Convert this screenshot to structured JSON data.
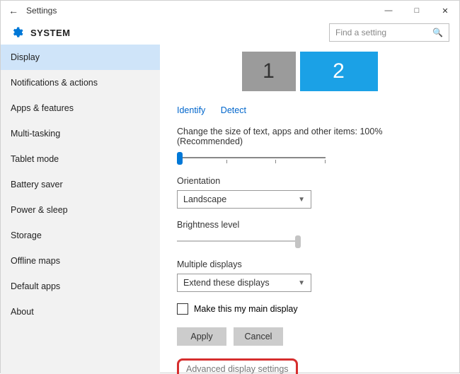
{
  "titlebar": {
    "title": "Settings"
  },
  "header": {
    "system": "SYSTEM",
    "search_placeholder": "Find a setting"
  },
  "sidebar": {
    "items": [
      {
        "label": "Display"
      },
      {
        "label": "Notifications & actions"
      },
      {
        "label": "Apps & features"
      },
      {
        "label": "Multi-tasking"
      },
      {
        "label": "Tablet mode"
      },
      {
        "label": "Battery saver"
      },
      {
        "label": "Power & sleep"
      },
      {
        "label": "Storage"
      },
      {
        "label": "Offline maps"
      },
      {
        "label": "Default apps"
      },
      {
        "label": "About"
      }
    ]
  },
  "main": {
    "monitor1": "1",
    "monitor2": "2",
    "identify": "Identify",
    "detect": "Detect",
    "scale_label": "Change the size of text, apps and other items: 100% (Recommended)",
    "orientation_label": "Orientation",
    "orientation_value": "Landscape",
    "brightness_label": "Brightness level",
    "multiple_label": "Multiple displays",
    "multiple_value": "Extend these displays",
    "main_display_label": "Make this my main display",
    "apply": "Apply",
    "cancel": "Cancel",
    "advanced": "Advanced display settings"
  }
}
